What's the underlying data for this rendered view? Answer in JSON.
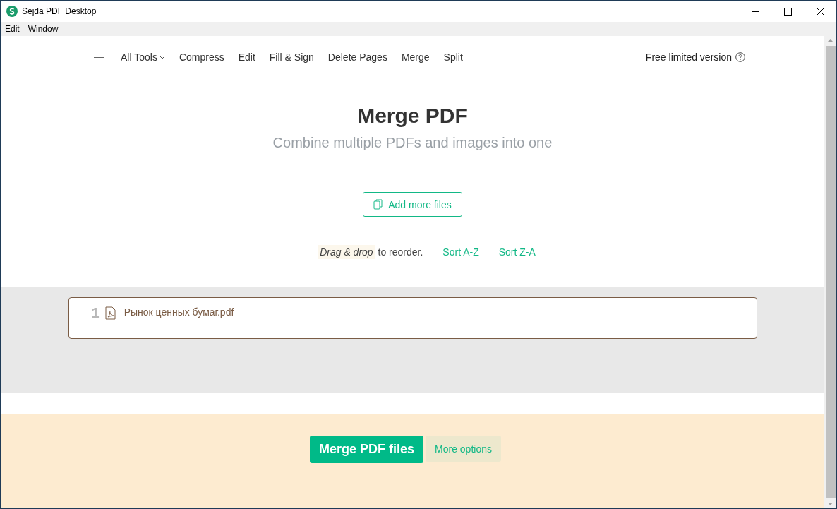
{
  "window": {
    "title": "Sejda PDF Desktop"
  },
  "menu_bar": [
    "Edit",
    "Window"
  ],
  "nav": {
    "dropdown": "All Tools",
    "links": [
      "Compress",
      "Edit",
      "Fill & Sign",
      "Delete Pages",
      "Merge",
      "Split"
    ],
    "version": "Free limited version"
  },
  "hero": {
    "title": "Merge PDF",
    "subtitle": "Combine multiple PDFs and images into one"
  },
  "add_button": "Add more files",
  "reorder": {
    "hint": "*Drag & drop* to reorder.",
    "sort_links": [
      "Sort A-Z",
      "Sort Z-A"
    ]
  },
  "files": [
    {
      "number": "1",
      "name": "Рынок ценных бумаг.pdf"
    }
  ],
  "actions": {
    "primary": "Merge PDF files",
    "secondary": "More options"
  }
}
